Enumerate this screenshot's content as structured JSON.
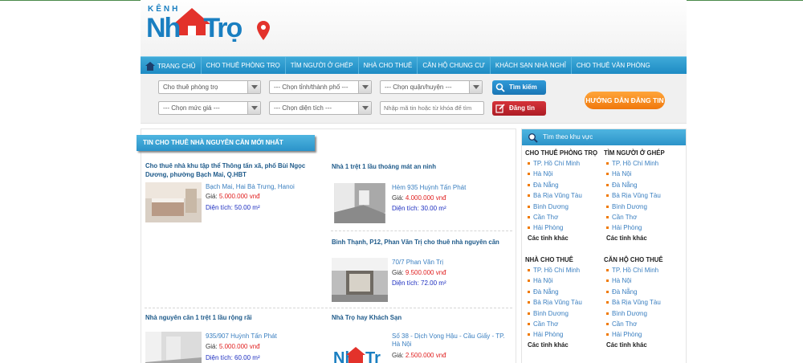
{
  "logo": {
    "small": "KÊNH",
    "main_left": "Nh",
    "main_right": "Trọ"
  },
  "nav": {
    "items": [
      {
        "label": "TRANG CHỦ"
      },
      {
        "label": "CHO THUÊ PHÒNG TRỌ"
      },
      {
        "label": "TÌM NGƯỜI Ở GHÉP"
      },
      {
        "label": "NHÀ CHO THUÊ"
      },
      {
        "label": "CĂN HỘ CHUNG CƯ"
      },
      {
        "label": "KHÁCH SẠN NHÀ NGHỈ"
      },
      {
        "label": "CHO THUÊ VĂN PHÒNG"
      }
    ]
  },
  "search": {
    "category": "Cho thuê phòng trọ",
    "province": "--- Chọn tỉnh/thành phố ---",
    "district": "--- Chọn quận/huyện ---",
    "price": "--- Chọn mức giá ---",
    "area": "--- Chọn diện tích ---",
    "keyword_placeholder": "Nhập mã tin hoặc từ khóa để tìm",
    "search_label": "Tìm kiếm",
    "post_label": "Đăng tin",
    "guide_label": "HƯỚNG DẪN ĐĂNG TIN"
  },
  "main": {
    "title": "TIN CHO THUÊ NHÀ NGUYÊN CĂN MỚI NHẤT",
    "listings": [
      {
        "title": "Cho thuê nhà khu tập thể Thông tấn xã, phố Bùi Ngọc Dương, phường Bạch Mai, Q.HBT",
        "location": "Bạch Mai, Hai Bà Trưng, Hanoi",
        "price_label": "Giá:",
        "price": "5.000.000 vnđ",
        "area_label": "Diện tích:",
        "area": "50.00 m²"
      },
      {
        "title": "Nhà 1 trệt 1 lầu thoáng mát an ninh",
        "location": "Hẻm 935 Huỳnh Tấn Phát",
        "price_label": "Giá:",
        "price": "4.000.000 vnđ",
        "area_label": "Diện tích:",
        "area": "30.00 m²"
      },
      {
        "title": "Bình Thạnh, P12, Phan Văn Trị cho thuê nhà nguyên căn",
        "location": "70/7 Phan Văn Trị",
        "price_label": "Giá:",
        "price": "9.500.000 vnđ",
        "area_label": "Diện tích:",
        "area": "72.00 m²"
      },
      {
        "title": "Nhà nguyên căn 1 trệt 1 lầu rộng rãi",
        "location": "935/907 Huỳnh Tấn Phát",
        "price_label": "Giá:",
        "price": "5.000.000 vnđ",
        "area_label": "Diện tích:",
        "area": "60.00 m²"
      },
      {
        "title": "Nhà Trọ hay Khách Sạn",
        "location": "Số 38 - Dịch Vọng Hậu - Cầu Giấy - TP. Hà Nội",
        "price_label": "Giá:",
        "price": "2.500.000 vnđ"
      }
    ]
  },
  "sidebar": {
    "title": "Tìm theo khu vực",
    "groups": [
      {
        "heading": "CHO THUÊ PHÒNG TRỌ",
        "items": [
          "TP. Hồ Chí Minh",
          "Hà Nội",
          "Đà Nẵng",
          "Bà Rịa Vũng Tàu",
          "Bình Dương",
          "Cần Thơ",
          "Hải Phòng"
        ],
        "more": "Các tỉnh khác"
      },
      {
        "heading": "TÌM NGƯỜI Ở GHÉP",
        "items": [
          "TP. Hồ Chí Minh",
          "Hà Nội",
          "Đà Nẵng",
          "Bà Rịa Vũng Tàu",
          "Bình Dương",
          "Cần Thơ",
          "Hải Phòng"
        ],
        "more": "Các tỉnh khác"
      },
      {
        "heading": "NHÀ CHO THUÊ",
        "items": [
          "TP. Hồ Chí Minh",
          "Hà Nội",
          "Đà Nẵng",
          "Bà Rịa Vũng Tàu",
          "Bình Dương",
          "Cần Thơ",
          "Hải Phòng"
        ],
        "more": "Các tỉnh khác"
      },
      {
        "heading": "CĂN HỘ CHO THUÊ",
        "items": [
          "TP. Hồ Chí Minh",
          "Hà Nội",
          "Đà Nẵng",
          "Bà Rịa Vũng Tàu",
          "Bình Dương",
          "Cần Thơ",
          "Hải Phòng"
        ],
        "more": "Các tỉnh khác"
      }
    ]
  },
  "colors": {
    "nav_blue": "#1e8bc4",
    "price_red": "#e02020",
    "area_blue": "#1c2ec0",
    "guide_orange": "#f0780c"
  }
}
